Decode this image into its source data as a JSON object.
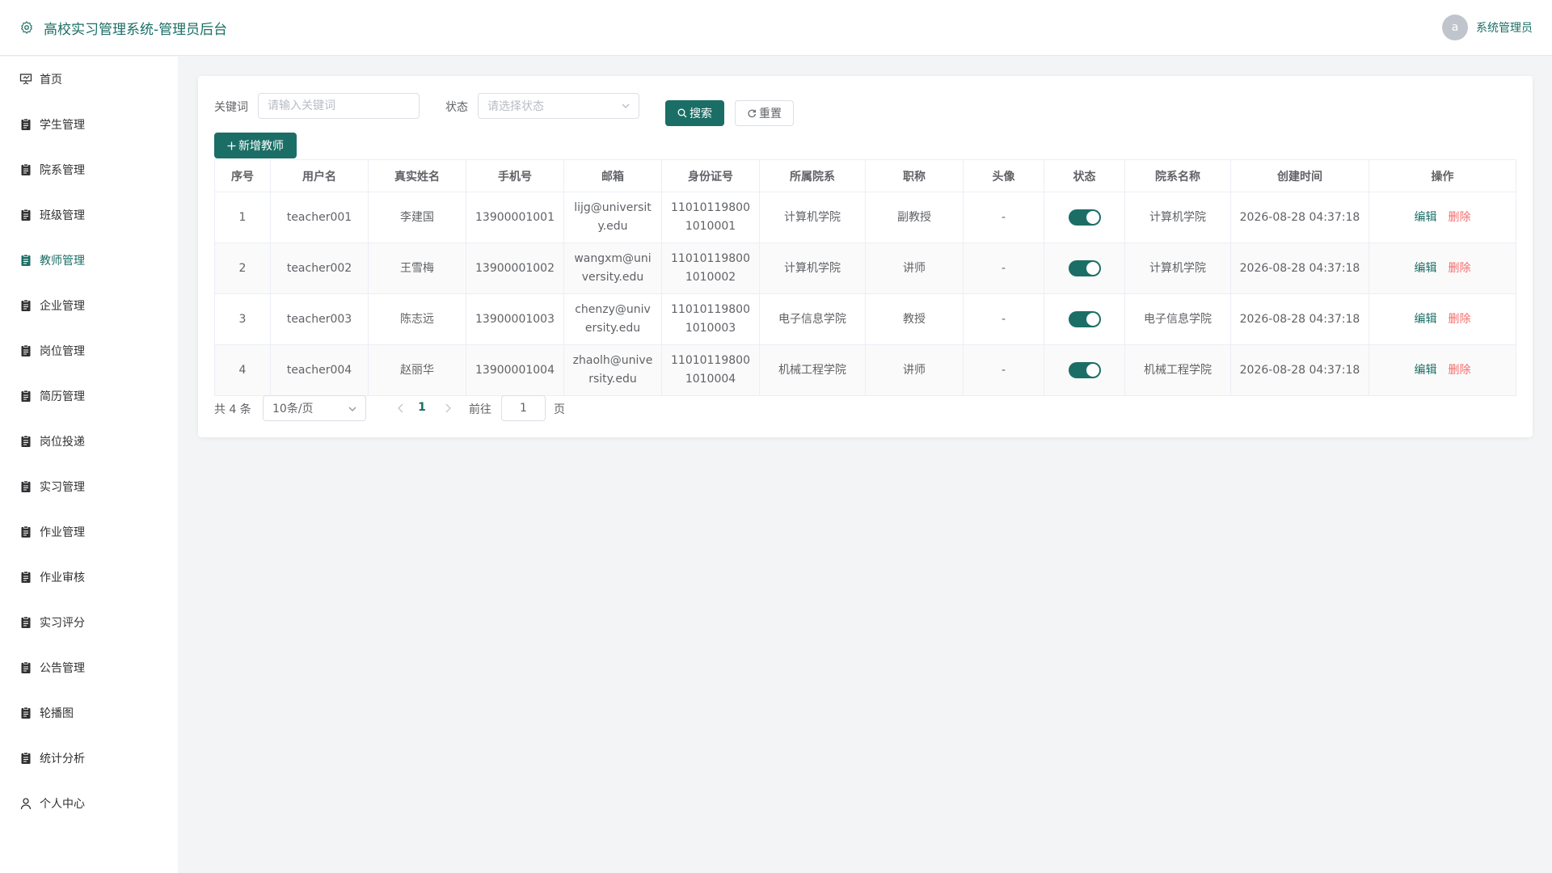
{
  "header": {
    "title": "高校实习管理系统-管理员后台",
    "avatar_letter": "a",
    "user_name": "系统管理员"
  },
  "colors": {
    "accent": "#1b6e66",
    "danger": "#f56c6c",
    "background": "#f2f4f5"
  },
  "sidebar": {
    "items": [
      {
        "label": "首页",
        "icon": "presentation-icon",
        "active": false
      },
      {
        "label": "学生管理",
        "icon": "clipboard-icon",
        "active": false
      },
      {
        "label": "院系管理",
        "icon": "clipboard-icon",
        "active": false
      },
      {
        "label": "班级管理",
        "icon": "clipboard-icon",
        "active": false
      },
      {
        "label": "教师管理",
        "icon": "clipboard-icon",
        "active": true
      },
      {
        "label": "企业管理",
        "icon": "clipboard-icon",
        "active": false
      },
      {
        "label": "岗位管理",
        "icon": "clipboard-icon",
        "active": false
      },
      {
        "label": "简历管理",
        "icon": "clipboard-icon",
        "active": false
      },
      {
        "label": "岗位投递",
        "icon": "clipboard-icon",
        "active": false
      },
      {
        "label": "实习管理",
        "icon": "clipboard-icon",
        "active": false
      },
      {
        "label": "作业管理",
        "icon": "clipboard-icon",
        "active": false
      },
      {
        "label": "作业审核",
        "icon": "clipboard-icon",
        "active": false
      },
      {
        "label": "实习评分",
        "icon": "clipboard-icon",
        "active": false
      },
      {
        "label": "公告管理",
        "icon": "clipboard-icon",
        "active": false
      },
      {
        "label": "轮播图",
        "icon": "clipboard-icon",
        "active": false
      },
      {
        "label": "统计分析",
        "icon": "clipboard-icon",
        "active": false
      },
      {
        "label": "个人中心",
        "icon": "user-icon",
        "active": false
      }
    ]
  },
  "filters": {
    "keyword_label": "关键词",
    "keyword_placeholder": "请输入关键词",
    "keyword_value": "",
    "status_label": "状态",
    "status_placeholder": "请选择状态",
    "search_label": "搜索",
    "reset_label": "重置",
    "add_label": "新增教师"
  },
  "table": {
    "columns": [
      "序号",
      "用户名",
      "真实姓名",
      "手机号",
      "邮箱",
      "身份证号",
      "所属院系",
      "职称",
      "头像",
      "状态",
      "院系名称",
      "创建时间",
      "操作"
    ],
    "rows": [
      {
        "index": "1",
        "username": "teacher001",
        "real_name": "李建国",
        "phone": "13900001001",
        "email": "lijg@university.edu",
        "id_card": "110101198001010001",
        "dept": "计算机学院",
        "title": "副教授",
        "avatar": "-",
        "status_on": true,
        "dept_name": "计算机学院",
        "created": "2026-08-28 04:37:18"
      },
      {
        "index": "2",
        "username": "teacher002",
        "real_name": "王雪梅",
        "phone": "13900001002",
        "email": "wangxm@university.edu",
        "id_card": "110101198001010002",
        "dept": "计算机学院",
        "title": "讲师",
        "avatar": "-",
        "status_on": true,
        "dept_name": "计算机学院",
        "created": "2026-08-28 04:37:18"
      },
      {
        "index": "3",
        "username": "teacher003",
        "real_name": "陈志远",
        "phone": "13900001003",
        "email": "chenzy@university.edu",
        "id_card": "110101198001010003",
        "dept": "电子信息学院",
        "title": "教授",
        "avatar": "-",
        "status_on": true,
        "dept_name": "电子信息学院",
        "created": "2026-08-28 04:37:18"
      },
      {
        "index": "4",
        "username": "teacher004",
        "real_name": "赵丽华",
        "phone": "13900001004",
        "email": "zhaolh@university.edu",
        "id_card": "110101198001010004",
        "dept": "机械工程学院",
        "title": "讲师",
        "avatar": "-",
        "status_on": true,
        "dept_name": "机械工程学院",
        "created": "2026-08-28 04:37:18"
      }
    ],
    "edit_label": "编辑",
    "delete_label": "删除"
  },
  "pagination": {
    "total_text": "共 4 条",
    "page_size": "10条/页",
    "current_page": "1",
    "goto_label": "前往",
    "goto_value": "1",
    "page_suffix": "页"
  }
}
